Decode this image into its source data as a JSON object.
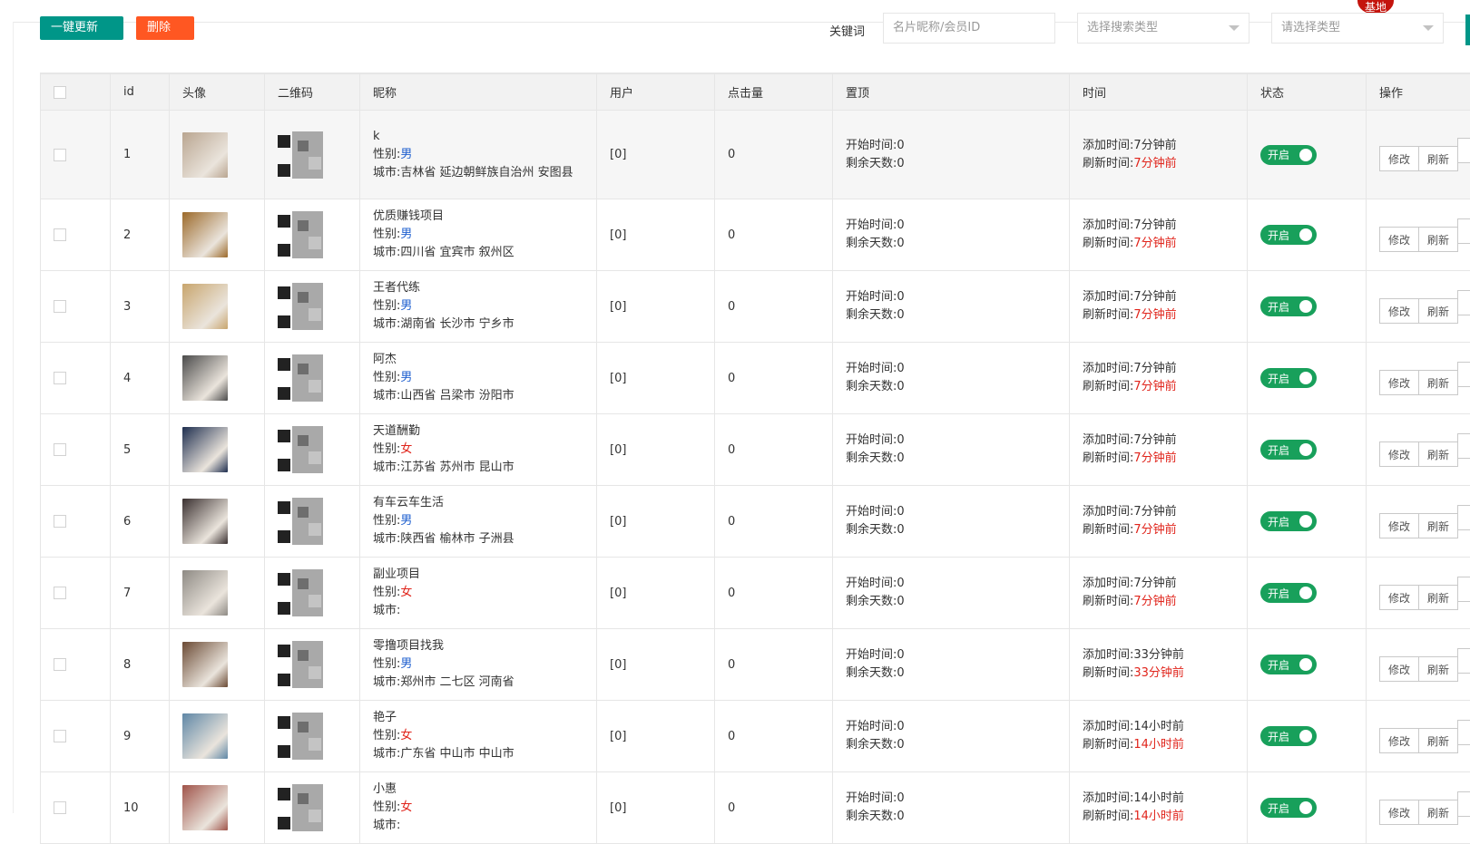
{
  "topbar": {
    "badge_text": "基地"
  },
  "toolbar": {
    "update_label": "一键更新",
    "delete_label": "删除",
    "keyword_label": "关键词",
    "keyword_placeholder": "名片昵称/会员ID",
    "search_type_placeholder": "选择搜索类型",
    "type_placeholder": "请选择类型"
  },
  "table": {
    "headers": [
      "id",
      "头像",
      "二维码",
      "昵称",
      "用户",
      "点击量",
      "置顶",
      "时间",
      "状态",
      "操作"
    ],
    "gender_prefix": "性别:",
    "city_prefix": "城市:",
    "start_prefix": "开始时间:",
    "days_prefix": "剩余天数:",
    "added_prefix": "添加时间:",
    "refreshed_prefix": "刷新时间:",
    "toggle_label": "开启",
    "edit_label": "修改",
    "refresh_label": "刷新",
    "rows": [
      {
        "id": "1",
        "nick": "k",
        "gender": "男",
        "gender_class": "male",
        "city": "吉林省 延边朝鲜族自治州 安图县",
        "user": "[0]",
        "clicks": "0",
        "start": "0",
        "days": "0",
        "added": "7分钟前",
        "refreshed": "7分钟前",
        "avatar_color": "#b9a590"
      },
      {
        "id": "2",
        "nick": "优质赚钱项目",
        "gender": "男",
        "gender_class": "male",
        "city": "四川省 宜宾市 叙州区",
        "user": "[0]",
        "clicks": "0",
        "start": "0",
        "days": "0",
        "added": "7分钟前",
        "refreshed": "7分钟前",
        "avatar_color": "#9c6a2a"
      },
      {
        "id": "3",
        "nick": "王者代练",
        "gender": "男",
        "gender_class": "male",
        "city": "湖南省 长沙市 宁乡市",
        "user": "[0]",
        "clicks": "0",
        "start": "0",
        "days": "0",
        "added": "7分钟前",
        "refreshed": "7分钟前",
        "avatar_color": "#c8a56d"
      },
      {
        "id": "4",
        "nick": "阿杰",
        "gender": "男",
        "gender_class": "male",
        "city": "山西省 吕梁市 汾阳市",
        "user": "[0]",
        "clicks": "0",
        "start": "0",
        "days": "0",
        "added": "7分钟前",
        "refreshed": "7分钟前",
        "avatar_color": "#4a4a4a"
      },
      {
        "id": "5",
        "nick": "天道酬勤",
        "gender": "女",
        "gender_class": "female",
        "city": "江苏省 苏州市 昆山市",
        "user": "[0]",
        "clicks": "0",
        "start": "0",
        "days": "0",
        "added": "7分钟前",
        "refreshed": "7分钟前",
        "avatar_color": "#1e2e4f"
      },
      {
        "id": "6",
        "nick": "有车云车生活",
        "gender": "男",
        "gender_class": "male",
        "city": "陕西省 榆林市 子洲县",
        "user": "[0]",
        "clicks": "0",
        "start": "0",
        "days": "0",
        "added": "7分钟前",
        "refreshed": "7分钟前",
        "avatar_color": "#3a3030"
      },
      {
        "id": "7",
        "nick": "副业项目",
        "gender": "女",
        "gender_class": "female",
        "city": "",
        "user": "[0]",
        "clicks": "0",
        "start": "0",
        "days": "0",
        "added": "7分钟前",
        "refreshed": "7分钟前",
        "avatar_color": "#8e8a84"
      },
      {
        "id": "8",
        "nick": "零撸项目找我",
        "gender": "男",
        "gender_class": "male",
        "city": "郑州市 二七区 河南省",
        "user": "[0]",
        "clicks": "0",
        "start": "0",
        "days": "0",
        "added": "33分钟前",
        "refreshed": "33分钟前",
        "avatar_color": "#6b4a34"
      },
      {
        "id": "9",
        "nick": "艳子",
        "gender": "女",
        "gender_class": "female",
        "city": "广东省 中山市 中山市",
        "user": "[0]",
        "clicks": "0",
        "start": "0",
        "days": "0",
        "added": "14小时前",
        "refreshed": "14小时前",
        "avatar_color": "#5f87a6"
      },
      {
        "id": "10",
        "nick": "小惠",
        "gender": "女",
        "gender_class": "female",
        "city": "",
        "user": "[0]",
        "clicks": "0",
        "start": "0",
        "days": "0",
        "added": "14小时前",
        "refreshed": "14小时前",
        "avatar_color": "#a0544a"
      }
    ]
  }
}
